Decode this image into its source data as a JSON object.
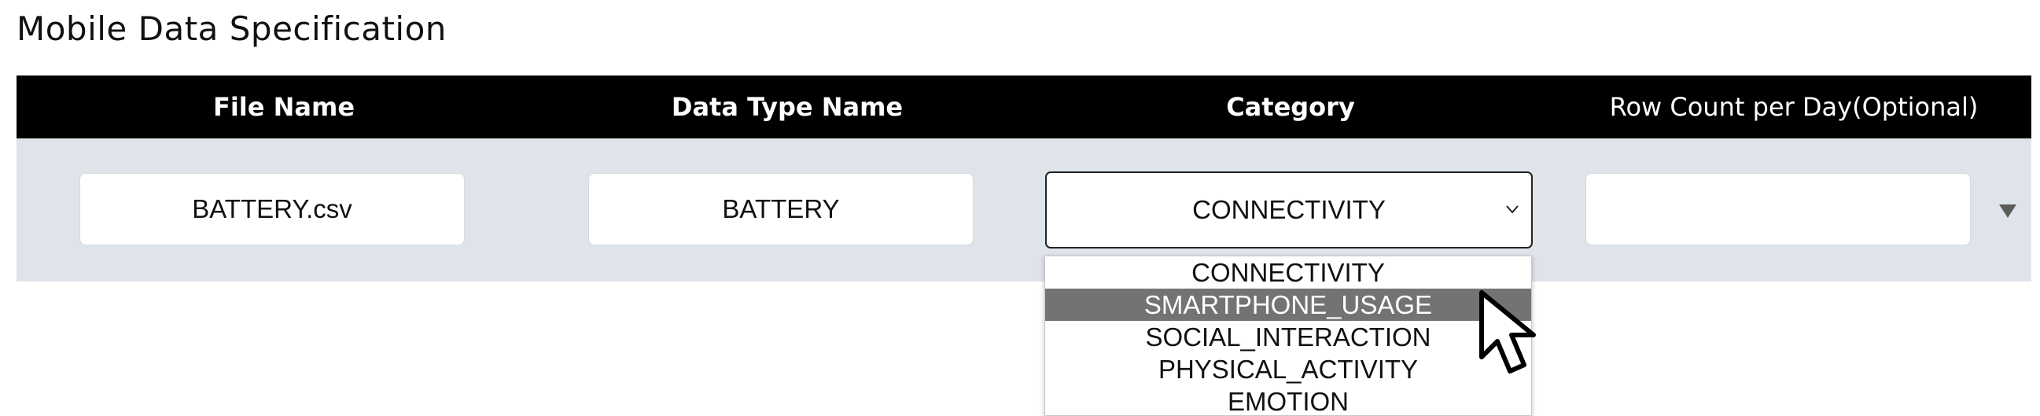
{
  "page": {
    "title": "Mobile Data Specification"
  },
  "table": {
    "headers": {
      "file_name": "File Name",
      "data_type_name": "Data Type Name",
      "category": "Category",
      "row_count": "Row Count per Day(Optional)"
    },
    "row": {
      "file_name": "BATTERY.csv",
      "data_type_name": "BATTERY",
      "category_selected": "CONNECTIVITY",
      "row_count": ""
    }
  },
  "category_dropdown": {
    "options": [
      "CONNECTIVITY",
      "SMARTPHONE_USAGE",
      "SOCIAL_INTERACTION",
      "PHYSICAL_ACTIVITY",
      "EMOTION"
    ],
    "highlighted": "SMARTPHONE_USAGE"
  },
  "icons": {
    "select_chevron": "chevron-down-icon",
    "row_expand": "triangle-down-icon",
    "pointer": "mouse-cursor-icon"
  },
  "colors": {
    "header_bg": "#000000",
    "row_bg": "#dee4ea",
    "highlight_bg": "#737373"
  }
}
